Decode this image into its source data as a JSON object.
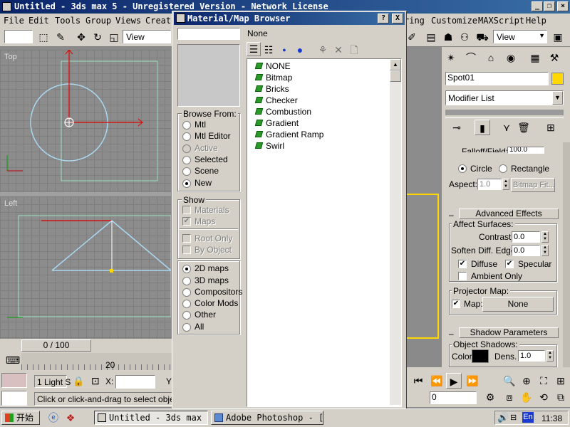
{
  "main_window": {
    "title": "Untitled - 3ds max 5 - Unregistered Version - Network License",
    "menu": [
      "File",
      "Edit",
      "Tools",
      "Group",
      "Views",
      "Create",
      "ring",
      "Customize",
      "MAXScript",
      "Help"
    ],
    "view_select_left": "View",
    "view_select_right": "View"
  },
  "viewports": {
    "top_label": "Top",
    "left_label": "Left"
  },
  "timeline": {
    "slider_label": "0 / 100",
    "ticks": [
      "0",
      "20"
    ]
  },
  "status": {
    "selection": "1 Light S",
    "x_label": "X:",
    "y_label": "Y",
    "prompt": "Click or click-and-drag to select object",
    "frame": "0"
  },
  "dialog": {
    "title": "Material/Map Browser",
    "help": "?",
    "close": "X",
    "name_field": "",
    "current_map": "None",
    "browse_from": {
      "title": "Browse From:",
      "options": [
        {
          "label": "Mtl",
          "selected": false,
          "disabled": false
        },
        {
          "label": "Mtl Editor",
          "selected": false,
          "disabled": false
        },
        {
          "label": "Active",
          "selected": false,
          "disabled": true
        },
        {
          "label": "Selected",
          "selected": false,
          "disabled": false
        },
        {
          "label": "Scene",
          "selected": false,
          "disabled": false
        },
        {
          "label": "New",
          "selected": true,
          "disabled": false
        }
      ]
    },
    "show": {
      "title": "Show",
      "materials": "Materials",
      "maps": "Maps",
      "root_only": "Root Only",
      "by_object": "By Object"
    },
    "map_types": [
      {
        "label": "2D maps",
        "selected": true
      },
      {
        "label": "3D maps",
        "selected": false
      },
      {
        "label": "Compositors",
        "selected": false
      },
      {
        "label": "Color Mods",
        "selected": false
      },
      {
        "label": "Other",
        "selected": false
      },
      {
        "label": "All",
        "selected": false
      }
    ],
    "list": [
      "NONE",
      "Bitmap",
      "Bricks",
      "Checker",
      "Combustion",
      "Gradient",
      "Gradient Ramp",
      "Swirl"
    ]
  },
  "command_panel": {
    "object_name": "Spot01",
    "modifier_list": "Modifier List",
    "falloff_label": "Falloff/Field:",
    "falloff_value": "100.0",
    "circle": "Circle",
    "rectangle": "Rectangle",
    "aspect_label": "Aspect:",
    "aspect_value": "1.0",
    "bitmap_fit": "Bitmap Fit...",
    "advanced_effects": "Advanced Effects",
    "affect_surfaces": "Affect Surfaces:",
    "contrast_label": "Contrast:",
    "contrast_value": "0.0",
    "soften_label": "Soften Diff. Edge:",
    "soften_value": "0.0",
    "diffuse": "Diffuse",
    "specular": "Specular",
    "ambient_only": "Ambient Only",
    "projector_map": "Projector Map:",
    "map_label": "Map:",
    "map_value": "None",
    "shadow_parameters": "Shadow Parameters",
    "object_shadows": "Object Shadows:",
    "color_label": "Color:",
    "dens_label": "Dens.",
    "dens_value": "1.0",
    "accent_color": "#ffd800"
  },
  "taskbar": {
    "start": "开始",
    "tasks": [
      "Untitled - 3ds max ...",
      "Adobe Photoshop - [..."
    ],
    "lang": "En",
    "clock": "11:38"
  }
}
